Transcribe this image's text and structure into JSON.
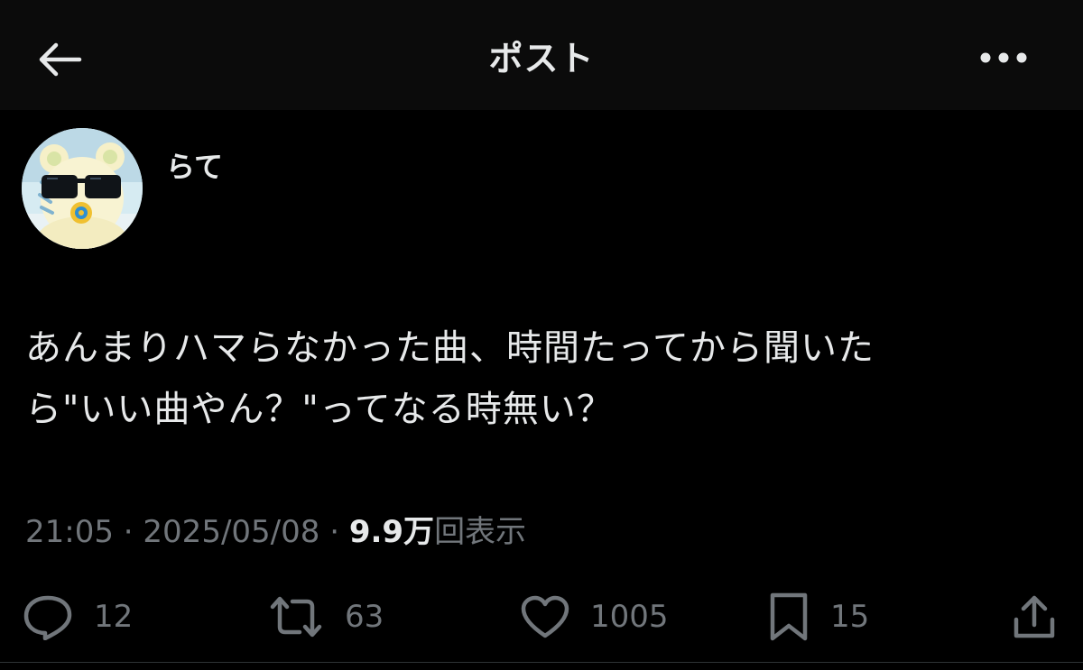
{
  "header": {
    "title": "ポスト",
    "back_icon": "arrow-left-icon",
    "more_icon": "more-horizontal-icon"
  },
  "post": {
    "author_name": "らて",
    "avatar_icon": "bear-with-sunglasses-avatar",
    "text_line1": "あんまりハマらなかった曲、時間たってから聞いた",
    "text_line2": "ら\"いい曲やん？\"ってなる時無い？",
    "time": "21:05",
    "separator1": " · ",
    "date": "2025/05/08",
    "separator2": " · ",
    "views_count": "9.9万",
    "views_label": "回表示"
  },
  "actions": {
    "replies": "12",
    "reposts": "63",
    "likes": "1005",
    "bookmarks": "15"
  },
  "colors": {
    "background": "#000000",
    "header_background": "#0b0b0b",
    "text_primary": "#e7e9ea",
    "text_secondary": "#71767b"
  }
}
